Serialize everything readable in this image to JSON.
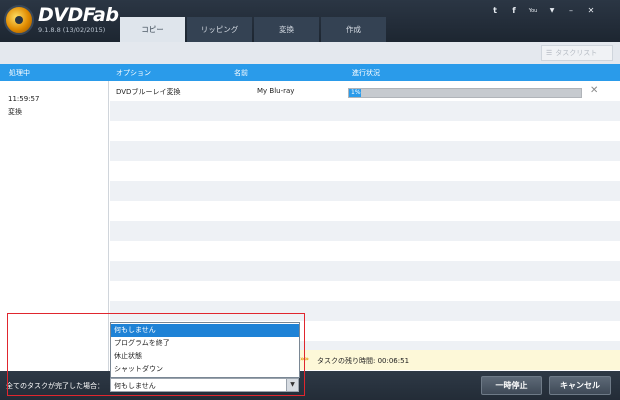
{
  "app": {
    "name": "DVDFab",
    "version": "9.1.8.8 (13/02/2015)"
  },
  "tabs": [
    {
      "label": "コピー",
      "active": true
    },
    {
      "label": "リッピング",
      "active": false
    },
    {
      "label": "変換",
      "active": false
    },
    {
      "label": "作成",
      "active": false
    }
  ],
  "title_icons": {
    "twitter": "t",
    "facebook": "f",
    "youtube": "You",
    "menu": "▼",
    "minimize": "–",
    "close": "✕"
  },
  "toolbar": {
    "tasklist_label": "タスクリスト"
  },
  "header": {
    "processing": "処理中",
    "option": "オプション",
    "name": "名前",
    "progress": "進行状況"
  },
  "left_panel": {
    "time": "11:59:57",
    "status": "変換"
  },
  "task": {
    "option": "DVDブルーレイ変換",
    "name": "My Blu-ray",
    "progress_text": "1%",
    "progress_value": 0.01
  },
  "remaining": {
    "text": "タスクの残り時間: 00:06:51"
  },
  "bottom": {
    "after_all_label": "全てのタスクが完了した場合：",
    "selected_value": "何もしません",
    "pause_label": "一時停止",
    "cancel_label": "キャンセル"
  },
  "dropdown": {
    "options": [
      "何もしません",
      "プログラムを終了",
      "休止状態",
      "シャットダウン"
    ],
    "selected_index": 0
  },
  "colors": {
    "header_blue": "#2a9bea",
    "highlight_red": "#e0262e"
  }
}
